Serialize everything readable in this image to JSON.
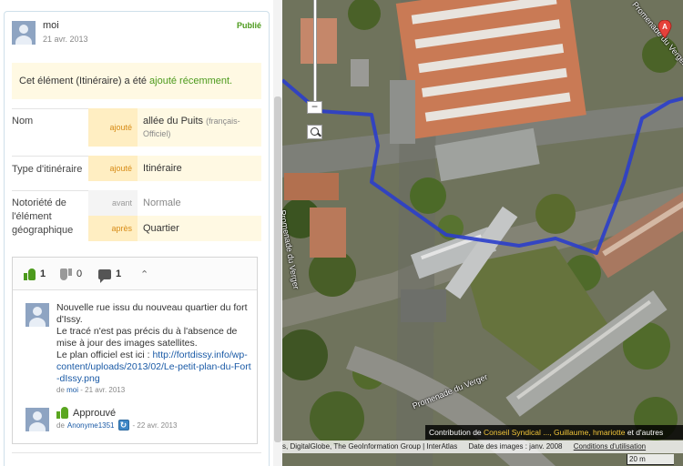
{
  "author": {
    "name": "moi",
    "date": "21 avr. 2013",
    "status": "Publié"
  },
  "notice": {
    "prefix": "Cet élément (Itinéraire) a été",
    "highlight": "ajouté récemment."
  },
  "fields": {
    "nom": {
      "label": "Nom",
      "tag": "ajouté",
      "value": "allée du Puits",
      "note": "(français-Officiel)"
    },
    "type": {
      "label": "Type d'itinéraire",
      "tag": "ajouté",
      "value": "Itinéraire"
    },
    "notoriete": {
      "label": "Notoriété de l'élément géographique",
      "before_tag": "avant",
      "before_value": "Normale",
      "after_tag": "après",
      "after_value": "Quartier"
    }
  },
  "comments_bar": {
    "up_count": "1",
    "down_count": "0",
    "comment_count": "1"
  },
  "comment": {
    "line1": "Nouvelle rue issu du nouveau quartier du fort d'Issy.",
    "line2": "Le tracé n'est pas précis du à l'absence de mise à jour des images satellites.",
    "line3": "Le plan officiel est ici :",
    "link": "http://fortdissy.info/wp-content/uploads/2013/02/Le-petit-plan-du-Fort-dIssy.png",
    "meta_prefix": "de",
    "meta_author": "moi",
    "meta_date": "- 21 avr. 2013"
  },
  "approval": {
    "label": "Approuvé",
    "meta_prefix": "de",
    "meta_author": "Anonyme1351",
    "meta_date": "- 22 avr. 2013"
  },
  "map": {
    "attribution_prefix": "Contribution de",
    "attribution_names": "Conseil Syndical ..., Guillaume, hmariotte",
    "attribution_suffix": "et d'autres",
    "footer_sources": "s, DigitalGlobe, The GeoInformation Group | InterAtlas",
    "footer_dates": "Date des images : janv. 2008",
    "footer_terms": "Conditions d'utilisation",
    "scale": "20 m",
    "street_1": "Promenade du Verger",
    "street_2": "Promenade du Verger",
    "street_3": "Promenade du Verger",
    "pin_letter": "A",
    "route_color": "#2b3ecb"
  },
  "icons": [
    "thumbs-up-icon",
    "thumbs-down-icon",
    "comment-bubble-icon",
    "chevron-up-icon",
    "zoom-out-icon",
    "magnifier-icon",
    "map-pin-icon"
  ],
  "colors": {
    "status_green": "#4c9a1c",
    "added_tag": "#d78b16",
    "highlight_bg": "#fff9e3",
    "link_blue": "#1a5aa6"
  }
}
